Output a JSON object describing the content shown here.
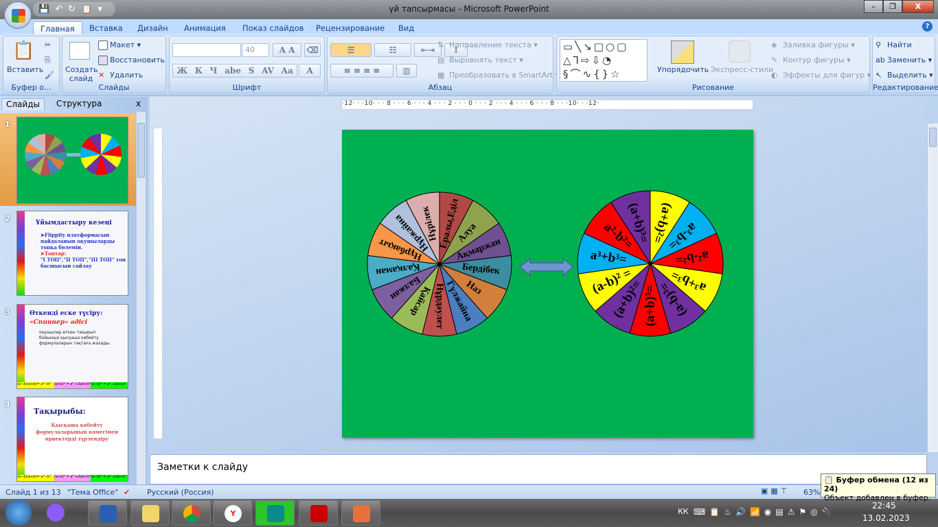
{
  "window": {
    "title": "үй тапсырмасы - Microsoft PowerPoint",
    "min": "–",
    "restore": "❐",
    "close": "X"
  },
  "tabs": [
    "Главная",
    "Вставка",
    "Дизайн",
    "Анимация",
    "Показ слайдов",
    "Рецензирование",
    "Вид"
  ],
  "ribbon": {
    "clipboard": {
      "label": "Буфер о...",
      "paste": "Вставить"
    },
    "slides": {
      "label": "Слайды",
      "new_slide": "Создать слайд",
      "layout": "Макет",
      "reset": "Восстановить",
      "delete": "Удалить"
    },
    "font": {
      "label": "Шрифт",
      "font_name": "",
      "size": "40",
      "buttons": [
        "Ж",
        "К",
        "Ч",
        "abe",
        "S",
        "AV",
        "Aa",
        "A"
      ]
    },
    "paragraph": {
      "label": "Абзац",
      "text_direction": "Направление текста",
      "align_text": "Выровнять текст",
      "smartart": "Преобразовать в SmartArt"
    },
    "drawing": {
      "label": "Рисование",
      "arrange": "Упорядочить",
      "quick_styles": "Экспресс-стили",
      "fill": "Заливка фигуры",
      "outline": "Контур фигуры",
      "effects": "Эффекты для фигур"
    },
    "editing": {
      "label": "Редактирование",
      "find": "Найти",
      "replace": "Заменить",
      "select": "Выделить"
    }
  },
  "left_panel": {
    "tabs": [
      "Слайды",
      "Структура"
    ],
    "close": "x",
    "slides": [
      {
        "num": "1"
      },
      {
        "num": "2",
        "title": "Ұйымдастыру кезеңі",
        "lines": [
          "➤Flippity платформасын пайдаланып оқушыларды топқа бөлемін.",
          "➤Топтар:",
          "\"І ТОП\",\"ІІ ТОП\",\"ІІІ ТОП\" топ басшысын сайлау"
        ]
      },
      {
        "num": "3",
        "title": "Өткенді еске түсіру:",
        "subtitle": "«Спиннер» әдісі",
        "lines": [
          "оқушылар өткен тақырып бойынша қысқаша көбейту формулаларын тақтаға жазады."
        ]
      },
      {
        "num": "4",
        "title": "Тақырыбы:",
        "lines": [
          "Қысқаша көбейту формулаларының көмегімен өрнектерді түрлендіру"
        ]
      }
    ],
    "strip": [
      "(a−b)(a+b)= a²−b²",
      "(a+b)² = a² +2ab+b²",
      "(a−b)² = a²−2ab+b²"
    ]
  },
  "ruler": {
    "h": "·12· · ·10· · · 8 · · · 6 · · · 4 · · · 2 · · · 0 · · · 2 · · · 4 · · · 6 · · · 8 · · ·10· · ·12·"
  },
  "slide": {
    "background": "#00b050",
    "names_wheel": [
      {
        "label": "Ералы,Еділ",
        "color": "#b14a44"
      },
      {
        "label": "Алуа",
        "color": "#8fa34e"
      },
      {
        "label": "Ақмаржан",
        "color": "#6f5192"
      },
      {
        "label": "Бердібек",
        "color": "#3c8da1"
      },
      {
        "label": "Наз",
        "color": "#d27f3b"
      },
      {
        "label": "Гүлжайна",
        "color": "#4b7fc0"
      },
      {
        "label": "Нұрдәулет",
        "color": "#c0504d"
      },
      {
        "label": "Қайсар",
        "color": "#9bbb59"
      },
      {
        "label": "Балжан",
        "color": "#7d5f9f"
      },
      {
        "label": "Қалқаман",
        "color": "#4bacc6"
      },
      {
        "label": "Нұрбақыт",
        "color": "#f79646"
      },
      {
        "label": "Нұржайна",
        "color": "#b0c0dd"
      },
      {
        "label": "Нұрілек",
        "color": "#ddadad"
      }
    ],
    "formula_wheel": [
      {
        "label": "(a+b)²=",
        "color": "#ffff00"
      },
      {
        "label": "a³-b³=",
        "color": "#00b0f0"
      },
      {
        "label": "a²-b²=",
        "color": "#ff0000"
      },
      {
        "label": "a³+b³=",
        "color": "#ffff00"
      },
      {
        "label": "(a-b)³=",
        "color": "#7030a0"
      },
      {
        "label": "(a+b)³=",
        "color": "#ff0000"
      },
      {
        "label": "(a+b)²=",
        "color": "#7030a0"
      },
      {
        "label": "(a-b)² =",
        "color": "#ffff00"
      },
      {
        "label": "a³+b³=",
        "color": "#00b0f0"
      },
      {
        "label": "a²-b²=",
        "color": "#ff0000"
      },
      {
        "label": "(a+b)³=",
        "color": "#7030a0"
      }
    ]
  },
  "notes": {
    "placeholder": "Заметки к слайду"
  },
  "status": {
    "slide": "Слайд 1 из 13",
    "theme": "\"Тема Office\"",
    "language": "Русский (Россия)",
    "zoom": "63%"
  },
  "tooltip": {
    "title": "Буфер обмена (12 из 24)",
    "body": "Объект добавлен в буфер."
  },
  "taskbar": {
    "lang": "КК",
    "time": "22:45",
    "date": "13.02.2023"
  }
}
